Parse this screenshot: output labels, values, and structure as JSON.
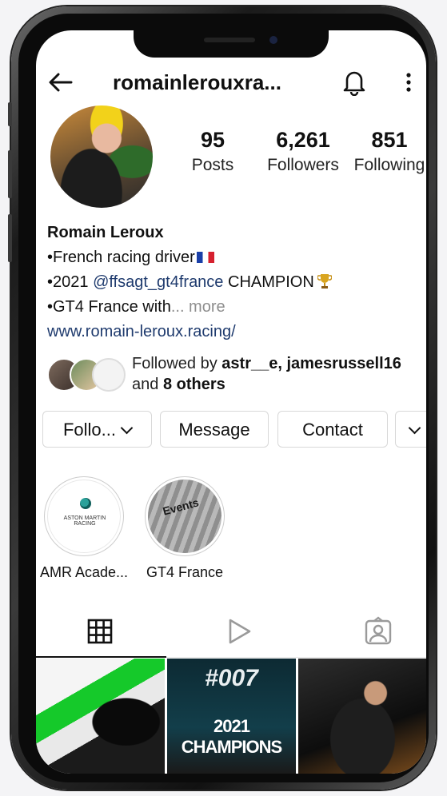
{
  "header": {
    "username": "romainlerouxra..."
  },
  "stats": [
    {
      "value": "95",
      "label": "Posts"
    },
    {
      "value": "6,261",
      "label": "Followers"
    },
    {
      "value": "851",
      "label": "Following"
    }
  ],
  "bio": {
    "name": "Romain Leroux",
    "line1": "•French racing driver",
    "line2_prefix": "•2021 ",
    "line2_mention": "@ffsagt_gt4france",
    "line2_suffix": " CHAMPION",
    "line3": "•GT4 France with",
    "line3_more": "... more",
    "website": "www.romain-leroux.racing/"
  },
  "followed_by": {
    "prefix": "Followed by ",
    "names": "astr__e, jamesrussell16",
    "middle": "and ",
    "others": "8 others"
  },
  "actions": {
    "follow": "Follo...",
    "message": "Message",
    "contact": "Contact"
  },
  "highlights": [
    {
      "label": "AMR Acade...",
      "logo_text": "ASTON MARTIN RACING"
    },
    {
      "label": "GT4 France",
      "logo_text": "Events"
    }
  ],
  "posts": [
    {
      "title": ""
    },
    {
      "number": "#007",
      "title": "2021 CHAMPIONS"
    },
    {
      "title": ""
    }
  ],
  "colors": {
    "link": "#1f3b6e",
    "muted": "#8e8e8e",
    "text": "#111111"
  }
}
